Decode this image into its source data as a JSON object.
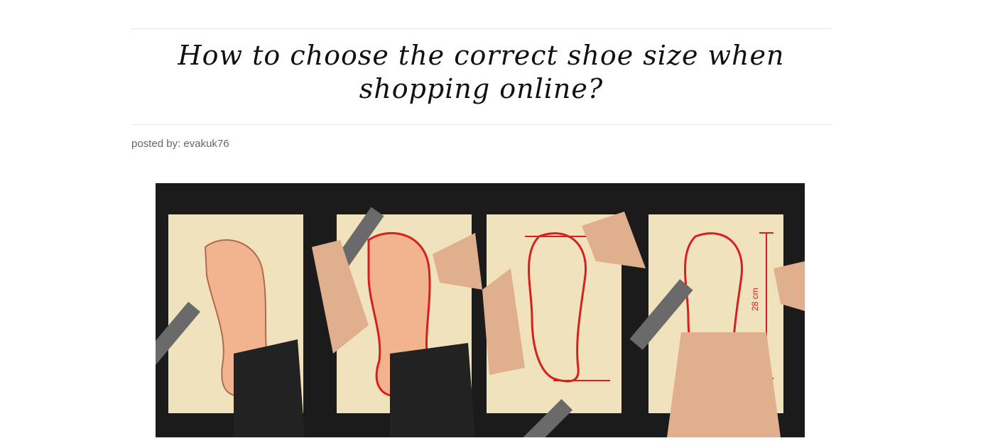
{
  "article": {
    "title": "How to choose the correct shoe size when shopping online?",
    "byline": "posted by: evakuk76",
    "image_measurement_label": "28 cm"
  },
  "colors": {
    "background": "#ffffff",
    "rule": "#e6e6e6",
    "title": "#111111",
    "byline": "#666666",
    "image_backdrop": "#1b1b1b",
    "paper": "#f0e2bd",
    "trace_red": "#d61f1f",
    "ruler": "#6a6a6a"
  }
}
